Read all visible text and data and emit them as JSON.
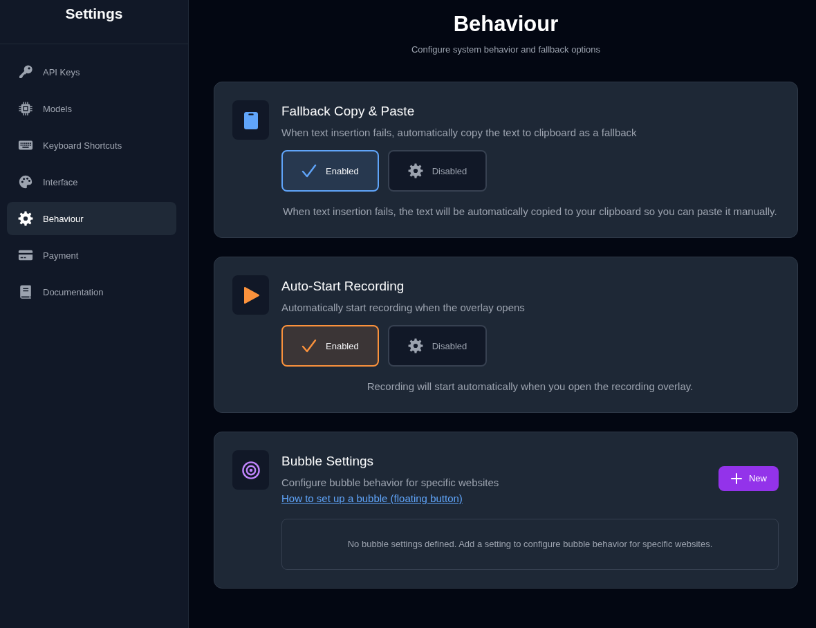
{
  "sidebar": {
    "title": "Settings",
    "items": [
      {
        "label": "API Keys",
        "selected": false
      },
      {
        "label": "Models",
        "selected": false
      },
      {
        "label": "Keyboard Shortcuts",
        "selected": false
      },
      {
        "label": "Interface",
        "selected": false
      },
      {
        "label": "Behaviour",
        "selected": true
      },
      {
        "label": "Payment",
        "selected": false
      },
      {
        "label": "Documentation",
        "selected": false
      }
    ]
  },
  "header": {
    "title": "Behaviour",
    "subtitle": "Configure system behavior and fallback options"
  },
  "cards": [
    {
      "kind": "toggle",
      "color": "#60a5fa",
      "title": "Fallback Copy & Paste",
      "description": "When text insertion fails, automatically copy the text to clipboard as a fallback",
      "options": [
        {
          "label": "Enabled",
          "selected": true
        },
        {
          "label": "Disabled",
          "selected": false
        }
      ],
      "note": "When text insertion fails, the text will be automatically copied to your clipboard so you can paste it manually."
    },
    {
      "kind": "toggle",
      "color": "#fb923c",
      "title": "Auto-Start Recording",
      "description": "Automatically start recording when the overlay opens",
      "options": [
        {
          "label": "Enabled",
          "selected": true
        },
        {
          "label": "Disabled",
          "selected": false
        }
      ],
      "note": "Recording will start automatically when you open the recording overlay."
    },
    {
      "kind": "list",
      "color": "#c084fc",
      "title": "Bubble Settings",
      "description": "Configure bubble behavior for specific websites",
      "link": "How to set up a bubble (floating button)",
      "button": "New",
      "empty_message": "No bubble settings defined. Add a setting to configure bubble behavior for specific websites."
    }
  ]
}
